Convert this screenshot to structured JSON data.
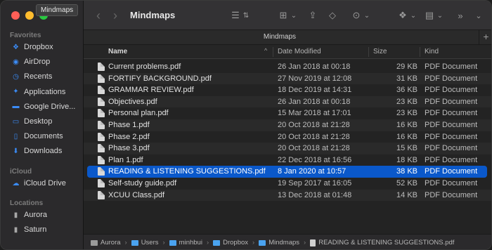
{
  "window": {
    "title": "Mindmaps",
    "tooltip": "Mindmaps"
  },
  "sidebar": {
    "favorites_label": "Favorites",
    "favorites": [
      {
        "label": "Dropbox",
        "icon": "dropbox-icon"
      },
      {
        "label": "AirDrop",
        "icon": "airdrop-icon"
      },
      {
        "label": "Recents",
        "icon": "clock-icon"
      },
      {
        "label": "Applications",
        "icon": "applications-icon"
      },
      {
        "label": "Google Drive...",
        "icon": "folder-icon"
      },
      {
        "label": "Desktop",
        "icon": "desktop-icon"
      },
      {
        "label": "Documents",
        "icon": "document-icon"
      },
      {
        "label": "Downloads",
        "icon": "download-icon"
      }
    ],
    "icloud_label": "iCloud",
    "icloud": [
      {
        "label": "iCloud Drive",
        "icon": "cloud-icon"
      }
    ],
    "locations_label": "Locations",
    "locations": [
      {
        "label": "Aurora",
        "icon": "disk-icon"
      },
      {
        "label": "Saturn",
        "icon": "disk-icon"
      }
    ]
  },
  "toolbar": {
    "back": "‹",
    "forward": "›",
    "title": "Mindmaps",
    "view_list": "☰",
    "view_grid": "⊞",
    "share": "⇪",
    "tag": "◇",
    "action": "⊙",
    "dropbox": "❖",
    "calendar": "▤",
    "more": "»",
    "chevron": "⌄"
  },
  "tabbar": {
    "title": "Mindmaps",
    "plus": "+"
  },
  "columns": {
    "name": "Name",
    "date": "Date Modified",
    "size": "Size",
    "kind": "Kind",
    "sort": "^"
  },
  "files": [
    {
      "name": "Current problems.pdf",
      "date": "26 Jan 2018 at 00:18",
      "size": "29 KB",
      "kind": "PDF Document"
    },
    {
      "name": "FORTIFY BACKGROUND.pdf",
      "date": "27 Nov 2019 at 12:08",
      "size": "31 KB",
      "kind": "PDF Document"
    },
    {
      "name": "GRAMMAR REVIEW.pdf",
      "date": "18 Dec 2019 at 14:31",
      "size": "36 KB",
      "kind": "PDF Document"
    },
    {
      "name": "Objectives.pdf",
      "date": "26 Jan 2018 at 00:18",
      "size": "23 KB",
      "kind": "PDF Document"
    },
    {
      "name": "Personal plan.pdf",
      "date": "15 Mar 2018 at 17:01",
      "size": "23 KB",
      "kind": "PDF Document"
    },
    {
      "name": "Phase 1.pdf",
      "date": "20 Oct 2018 at 21:28",
      "size": "16 KB",
      "kind": "PDF Document"
    },
    {
      "name": "Phase 2.pdf",
      "date": "20 Oct 2018 at 21:28",
      "size": "16 KB",
      "kind": "PDF Document"
    },
    {
      "name": "Phase 3.pdf",
      "date": "20 Oct 2018 at 21:28",
      "size": "15 KB",
      "kind": "PDF Document"
    },
    {
      "name": "Plan 1.pdf",
      "date": "22 Dec 2018 at 16:56",
      "size": "18 KB",
      "kind": "PDF Document"
    },
    {
      "name": "READING & LISTENING SUGGESTIONS.pdf",
      "date": "8 Jan 2020 at 10:57",
      "size": "38 KB",
      "kind": "PDF Document"
    },
    {
      "name": "Self-study guide.pdf",
      "date": "19 Sep 2017 at 16:05",
      "size": "52 KB",
      "kind": "PDF Document"
    },
    {
      "name": "XCUU Class.pdf",
      "date": "13 Dec 2018 at 01:48",
      "size": "14 KB",
      "kind": "PDF Document"
    }
  ],
  "selected_file": "READING & LISTENING SUGGESTIONS.pdf",
  "pathbar": [
    "Aurora",
    "Users",
    "minhbui",
    "Dropbox",
    "Mindmaps",
    "READING & LISTENING SUGGESTIONS.pdf"
  ],
  "colors": {
    "selection": "#0a58ca",
    "sidebar_icon": "#3b8cf7",
    "folder": "#4aa3f0"
  }
}
